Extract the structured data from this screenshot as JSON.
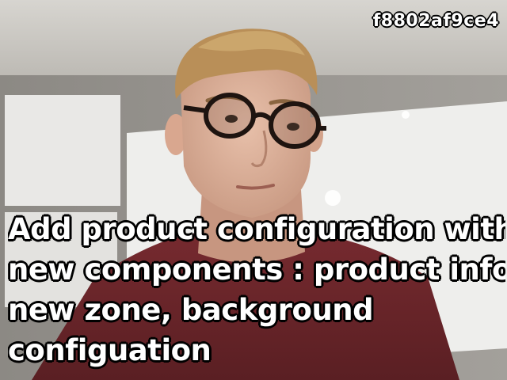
{
  "overlay": {
    "hash": "f8802af9ce4",
    "caption_lines": [
      "Add product configuration with",
      "new components : product infos,",
      "new zone, background",
      "configuation"
    ]
  },
  "colors": {
    "caption_text": "#ffffff",
    "caption_outline": "#000000",
    "shirt": "#6b2529",
    "wall": "#9b9893"
  },
  "scene": {
    "subject": "person-with-round-glasses",
    "background": "office-wall-with-whiteboard"
  }
}
